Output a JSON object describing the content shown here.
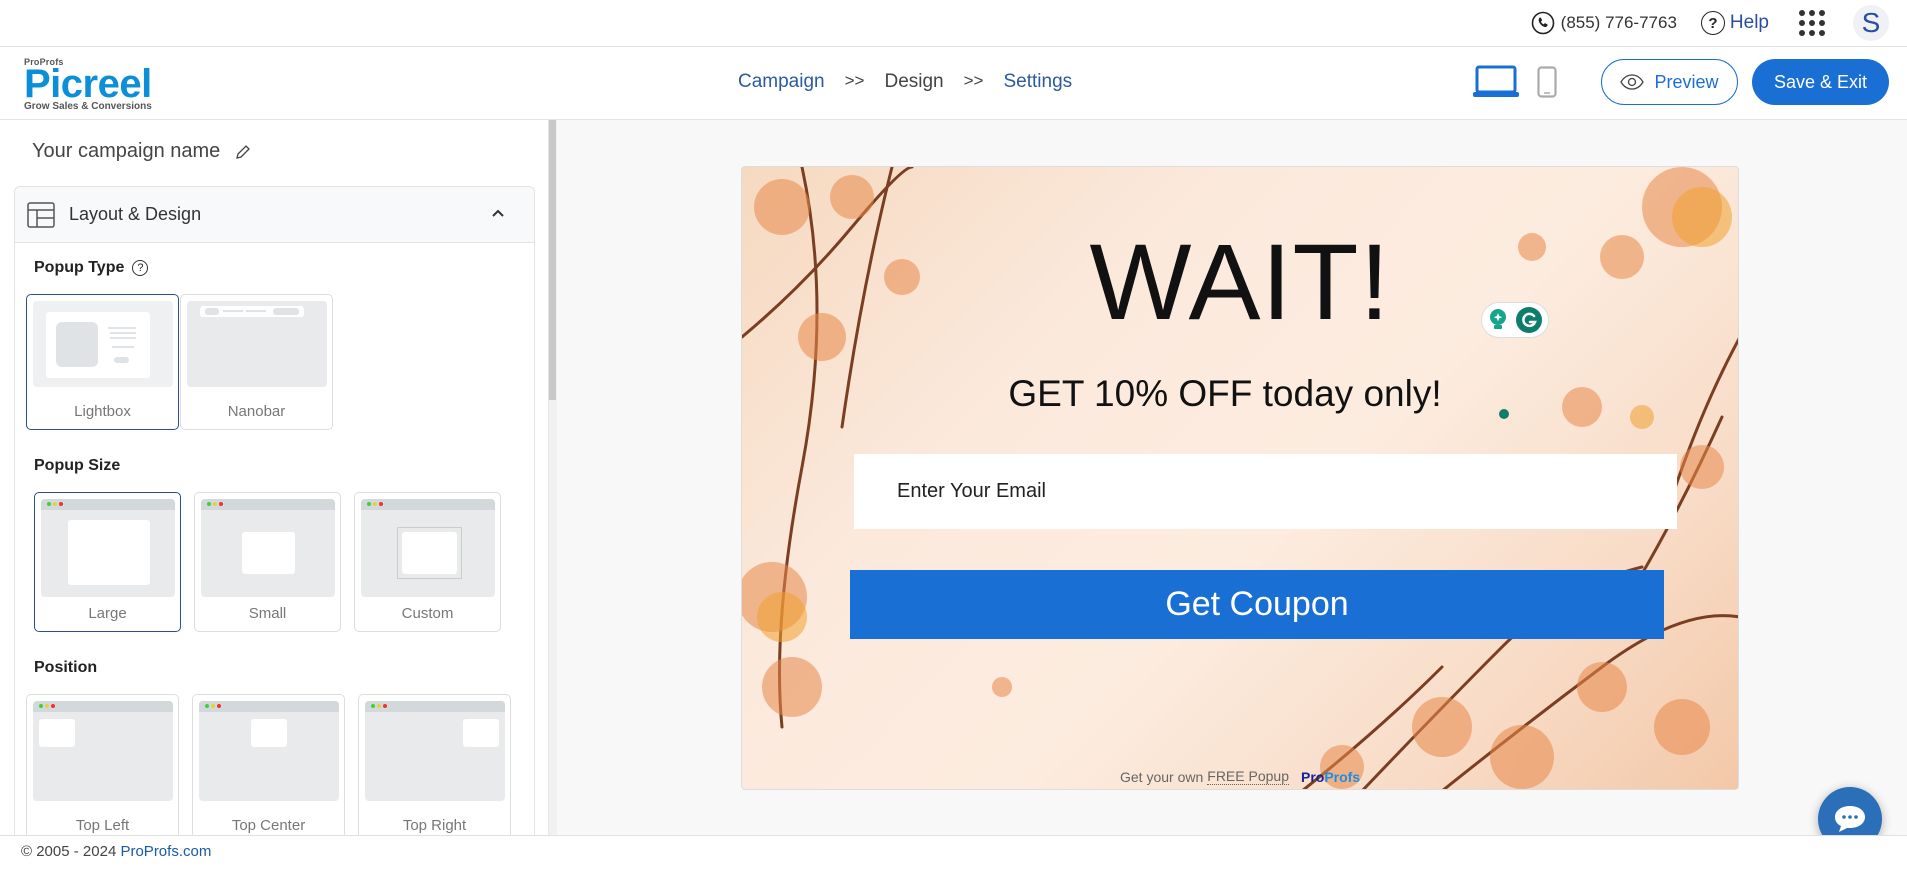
{
  "topbar": {
    "phone": "(855) 776-7763",
    "help": "Help",
    "avatar_initial": "S",
    "icons": [
      "phone-icon",
      "help-icon",
      "apps-grid-icon"
    ]
  },
  "header": {
    "logo": {
      "brand": "ProProfs",
      "name": "Picreel",
      "tagline": "Grow Sales & Conversions"
    },
    "steps": [
      {
        "label": "Campaign",
        "state": "link"
      },
      {
        "label": "Design",
        "state": "current"
      },
      {
        "label": "Settings",
        "state": "link"
      }
    ],
    "step_separator": ">>",
    "device_toggle": {
      "active": "desktop",
      "options": [
        "desktop",
        "mobile"
      ]
    },
    "preview_label": "Preview",
    "save_label": "Save & Exit"
  },
  "sidebar": {
    "campaign_name": "Your campaign name",
    "panel_title": "Layout & Design",
    "popup_type": {
      "title": "Popup Type",
      "options": [
        "Lightbox",
        "Nanobar"
      ],
      "selected": "Lightbox"
    },
    "popup_size": {
      "title": "Popup Size",
      "options": [
        "Large",
        "Small",
        "Custom"
      ],
      "selected": "Large"
    },
    "position": {
      "title": "Position",
      "options": [
        "Top Left",
        "Top Center",
        "Top Right"
      ]
    }
  },
  "popup": {
    "headline": "WAIT!",
    "subheadline": "GET 10% OFF today only!",
    "email_placeholder": "Enter Your Email",
    "button_label": "Get Coupon",
    "powered_text": "Get your own",
    "powered_link": "FREE Popup",
    "powered_brand_a": "Pro",
    "powered_brand_b": "Profs",
    "colors": {
      "button": "#1a6fd4",
      "brand_dark": "#14239a",
      "brand_light": "#1a8fe8"
    }
  },
  "footer": {
    "copyright": "© 2005 - 2024",
    "link": "ProProfs.com"
  },
  "colors": {
    "accent": "#1a6fd4",
    "link": "#2a5aa2",
    "logo": "#0d8fd8"
  }
}
